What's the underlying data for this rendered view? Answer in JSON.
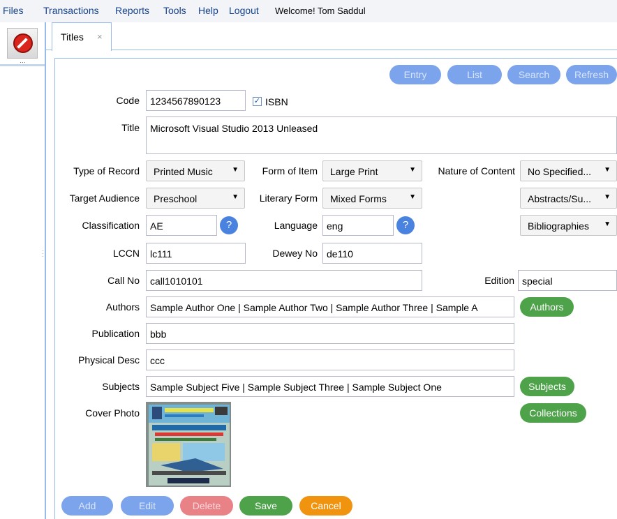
{
  "menu": {
    "items": [
      "Files",
      "Transactions",
      "Reports",
      "Tools",
      "Help",
      "Logout"
    ],
    "welcome": "Welcome! Tom Saddul"
  },
  "tab": {
    "label": "Titles",
    "close": "×"
  },
  "toolbar": {
    "entry": "Entry",
    "list": "List",
    "search": "Search",
    "refresh": "Refresh"
  },
  "form": {
    "code": {
      "label": "Code",
      "value": "1234567890123"
    },
    "isbn": {
      "label": "ISBN",
      "checked": true
    },
    "title": {
      "label": "Title",
      "value": "Microsoft Visual Studio 2013 Unleased"
    },
    "type_of_record": {
      "label": "Type of Record",
      "value": "Printed Music"
    },
    "form_of_item": {
      "label": "Form of Item",
      "value": "Large Print"
    },
    "nature_of_content": {
      "label": "Nature of Content",
      "value": "No Specified..."
    },
    "target_audience": {
      "label": "Target Audience",
      "value": "Preschool"
    },
    "literary_form": {
      "label": "Literary Form",
      "value": "Mixed Forms"
    },
    "nature_of_content_2": {
      "value": "Abstracts/Su..."
    },
    "classification": {
      "label": "Classification",
      "value": "AE",
      "help": "?"
    },
    "language": {
      "label": "Language",
      "value": "eng",
      "help": "?"
    },
    "nature_of_content_3": {
      "value": "Bibliographies"
    },
    "lccn": {
      "label": "LCCN",
      "value": "lc111"
    },
    "dewey_no": {
      "label": "Dewey No",
      "value": "de110"
    },
    "call_no": {
      "label": "Call No",
      "value": "call1010101"
    },
    "edition": {
      "label": "Edition",
      "value": "special"
    },
    "authors": {
      "label": "Authors",
      "value": "Sample Author One | Sample Author Two | Sample Author Three | Sample A",
      "button": "Authors"
    },
    "publication": {
      "label": "Publication",
      "value": "bbb"
    },
    "physical_desc": {
      "label": "Physical Desc",
      "value": "ccc"
    },
    "subjects": {
      "label": "Subjects",
      "value": "Sample Subject Five | Sample Subject Three | Sample Subject One",
      "button": "Subjects"
    },
    "cover_photo": {
      "label": "Cover Photo"
    },
    "collections_button": "Collections"
  },
  "actions": {
    "add": "Add",
    "edit": "Edit",
    "delete": "Delete",
    "save": "Save",
    "cancel": "Cancel"
  },
  "colors": {
    "blue": "#4a82e0",
    "green": "#4ea34a",
    "red": "#e98286",
    "orange": "#f0940f",
    "menu_text": "#15428b"
  }
}
